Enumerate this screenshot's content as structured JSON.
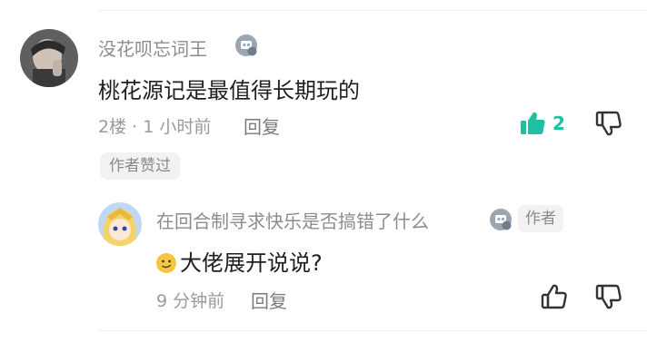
{
  "comment": {
    "author": "没花呗忘词王",
    "text": "桃花源记是最值得长期玩的",
    "floor": "2楼",
    "separator": "·",
    "time": "1 小时前",
    "reply_label": "回复",
    "like_count": "2",
    "author_liked_chip": "作者赞过",
    "colors": {
      "like_active": "#1fbf9f"
    }
  },
  "reply": {
    "author": "在回合制寻求快乐是否搞错了什么",
    "author_tag": "作者",
    "text": "大佬展开说说?",
    "time": "9 分钟前",
    "reply_label": "回复"
  }
}
